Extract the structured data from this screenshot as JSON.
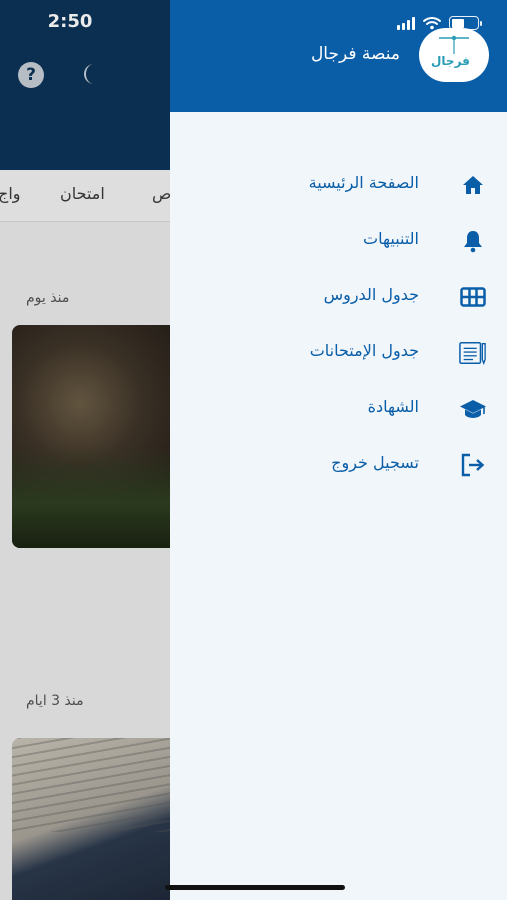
{
  "status_bar": {
    "time": "2:50"
  },
  "background_app": {
    "tabs": [
      "امتحان",
      "واج",
      "ص"
    ],
    "posts": [
      {
        "time_ago": "منذ يوم"
      },
      {
        "time_ago": "منذ 3 ايام"
      }
    ]
  },
  "drawer": {
    "logo_text": "فرجال",
    "app_name": "منصة فرجال",
    "menu": [
      {
        "label": "الصفحة الرئيسية",
        "icon": "home-icon"
      },
      {
        "label": "التنبيهات",
        "icon": "bell-icon"
      },
      {
        "label": "جدول الدروس",
        "icon": "grid-table-icon"
      },
      {
        "label": "جدول الإمتحانات",
        "icon": "exam-sheet-icon"
      },
      {
        "label": "الشهادة",
        "icon": "graduation-cap-icon"
      },
      {
        "label": "تسجيل خروج",
        "icon": "logout-icon"
      }
    ]
  },
  "colors": {
    "accent": "#0a5ea8",
    "header_dark": "#0b3357",
    "drawer_bg": "#f1f6fb"
  }
}
